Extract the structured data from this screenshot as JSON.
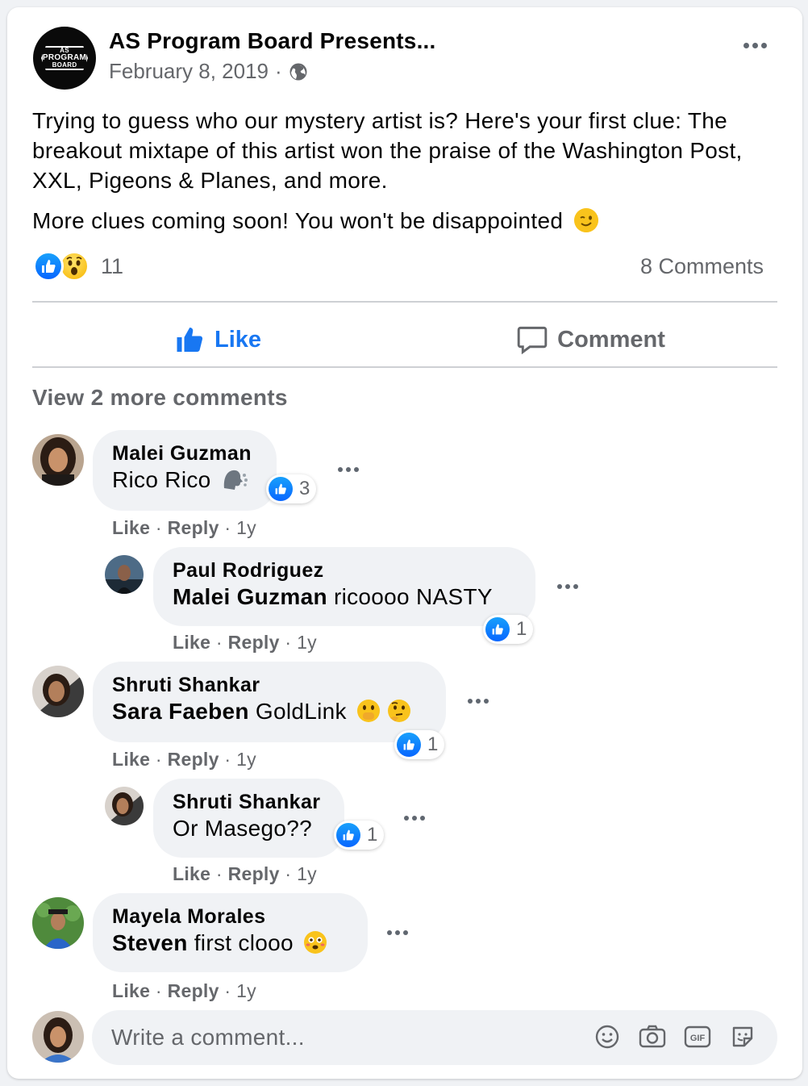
{
  "post": {
    "page_name": "AS Program Board Presents...",
    "date": "February 8, 2019",
    "separator": "·",
    "logo_lines": [
      "AS",
      "PROGRAM",
      "BOARD"
    ],
    "text_paragraph_1": "Trying to guess who our mystery artist is? Here's your first clue: The breakout mixtape of this artist won the praise of the Washington Post, XXL, Pigeons & Planes, and more.",
    "text_paragraph_2": "More clues coming soon! You won't be disappointed",
    "reaction_count": "11",
    "comments_count": "8 Comments"
  },
  "actions": {
    "like_label": "Like",
    "comment_label": "Comment"
  },
  "view_more": "View 2 more comments",
  "comments": [
    {
      "name": "Malei Guzman",
      "mention": "",
      "text": "Rico Rico",
      "reactions": "3",
      "like": "Like",
      "reply": "Reply",
      "time": "1y"
    },
    {
      "name": "Paul Rodriguez",
      "mention": "Malei Guzman",
      "text": "ricoooo NASTY",
      "reactions": "1",
      "like": "Like",
      "reply": "Reply",
      "time": "1y"
    },
    {
      "name": "Shruti Shankar",
      "mention": "Sara Faeben",
      "text": "GoldLink",
      "reactions": "1",
      "like": "Like",
      "reply": "Reply",
      "time": "1y"
    },
    {
      "name": "Shruti Shankar",
      "mention": "",
      "text": "Or Masego??",
      "reactions": "1",
      "like": "Like",
      "reply": "Reply",
      "time": "1y"
    },
    {
      "name": "Mayela Morales",
      "mention": "Steven",
      "text": "first clooo",
      "reactions": "",
      "like": "Like",
      "reply": "Reply",
      "time": "1y"
    }
  ],
  "write_comment": {
    "placeholder": "Write a comment...",
    "icons": [
      "emoji-icon",
      "camera-icon",
      "gif-icon",
      "sticker-icon"
    ]
  },
  "colors": {
    "accent": "#1877f2",
    "secondary_text": "#65676b",
    "bubble": "#f0f2f5"
  }
}
